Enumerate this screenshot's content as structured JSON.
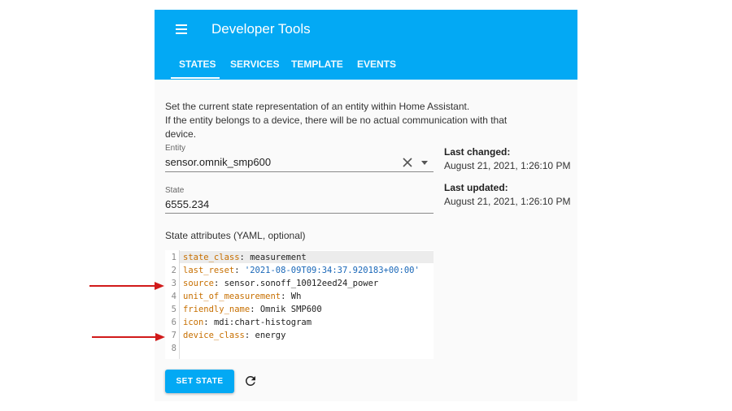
{
  "header": {
    "title": "Developer Tools",
    "menu_icon": "hamburger-menu-icon"
  },
  "tabs": [
    {
      "label": "STATES",
      "active": true
    },
    {
      "label": "SERVICES",
      "active": false
    },
    {
      "label": "TEMPLATE",
      "active": false
    },
    {
      "label": "EVENTS",
      "active": false
    }
  ],
  "description": {
    "line1": "Set the current state representation of an entity within Home Assistant.",
    "line2": "If the entity belongs to a device, there will be no actual communication with that device."
  },
  "entity_field": {
    "label": "Entity",
    "value": "sensor.omnik_smp600"
  },
  "state_field": {
    "label": "State",
    "value": "6555.234"
  },
  "last_changed": {
    "label": "Last changed:",
    "value": "August 21, 2021, 1:26:10 PM"
  },
  "last_updated": {
    "label": "Last updated:",
    "value": "August 21, 2021, 1:26:10 PM"
  },
  "attributes_title": "State attributes (YAML, optional)",
  "yaml_lines": [
    {
      "num": "1",
      "key": "state_class",
      "sep": ": ",
      "value": "measurement",
      "string": false
    },
    {
      "num": "2",
      "key": "last_reset",
      "sep": ": ",
      "value": "'2021-08-09T09:34:37.920183+00:00'",
      "string": true
    },
    {
      "num": "3",
      "key": "source",
      "sep": ": ",
      "value": "sensor.sonoff_10012eed24_power",
      "string": false
    },
    {
      "num": "4",
      "key": "unit_of_measurement",
      "sep": ": ",
      "value": "Wh",
      "string": false
    },
    {
      "num": "5",
      "key": "friendly_name",
      "sep": ": ",
      "value": "Omnik SMP600",
      "string": false
    },
    {
      "num": "6",
      "key": "icon",
      "sep": ": ",
      "value": "mdi:chart-histogram",
      "string": false
    },
    {
      "num": "7",
      "key": "device_class",
      "sep": ": ",
      "value": "energy",
      "string": false
    },
    {
      "num": "8",
      "key": "",
      "sep": "",
      "value": "",
      "string": false
    }
  ],
  "set_state_button": "SET STATE",
  "colors": {
    "accent": "#03a9f4",
    "yaml_key": "#c76f00",
    "yaml_string": "#1967b8",
    "arrow": "#d11a1a"
  }
}
